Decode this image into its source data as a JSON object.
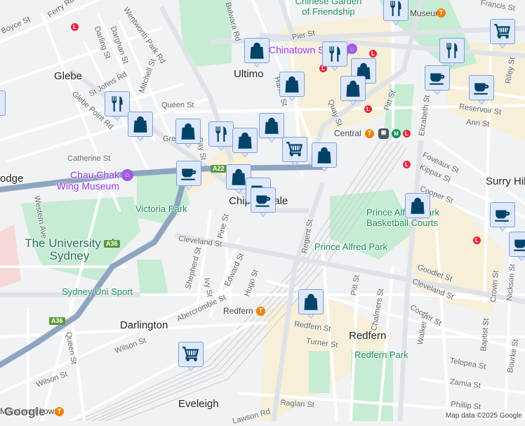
{
  "map": {
    "attribution": "Map data ©2025 Google",
    "logo": "Google",
    "marker_color": "#004369",
    "route_shields": [
      "A22",
      "A36",
      "A36"
    ],
    "suburbs": [
      "Glebe",
      "Ultimo",
      "Chippendale",
      "Darlington",
      "Redfern",
      "Eveleigh",
      "Surry Hills",
      "odge"
    ],
    "parks": [
      "Victoria Park",
      "Prince Alfred Park",
      "Redfern Park",
      "Sydney Uni Sport",
      "Prince Alfred Park Basketball Courts",
      "Chinese Garden of Friendship"
    ],
    "institutions": [
      "The University of Sydney"
    ],
    "pois": [
      "Chau Chak Wing Museum",
      "Chinatown Sydney"
    ],
    "stations": [
      "Central",
      "Redfern",
      "Museum",
      "Macdonaldtown"
    ],
    "streets": [
      "Wentworth Park Rd",
      "Glebe Point Rd",
      "St Johns Rd",
      "Mitchell St",
      "Darling St",
      "Darghan St",
      "Queen St",
      "Catherine St",
      "Cleveland St",
      "Cleveland St",
      "Abercrombie St",
      "Regent St",
      "Pitt St",
      "Pitt St",
      "Quay St",
      "Elizabeth St",
      "Foveaux St",
      "Kippax St",
      "Cooper St",
      "Cooper St",
      "Reservoir St",
      "Ann St",
      "Riley St",
      "Pier St",
      "Bulwara Rd",
      "Francis St",
      "Shepherd St",
      "Ivy St",
      "Pine St",
      "Edward St",
      "Hugo St",
      "Western Ave",
      "Queen St",
      "Wilson St",
      "Wilson St",
      "Redfern St",
      "Turner St",
      "Chalmers St",
      "Walker St",
      "Goodlet St",
      "Crown St",
      "Nickson St",
      "Baptist St",
      "Bourke St",
      "Telopea St",
      "Zamia St",
      "Raglan St",
      "Phillip St",
      "Boyce St",
      "Ferry Rd",
      "Harris St",
      "Greek St",
      "Bay St",
      "Lawson Rd"
    ],
    "markers": [
      "shopping",
      "restaurant",
      "shopping",
      "shopping",
      "restaurant",
      "shopping",
      "shopping",
      "shopping",
      "shopping",
      "shopping",
      "restaurant",
      "restaurant",
      "grocery",
      "restaurant",
      "cafe",
      "cafe",
      "grocery",
      "shopping",
      "shopping",
      "cafe",
      "cafe",
      "cafe",
      "shopping",
      "cafe",
      "cafe",
      "shopping",
      "grocery",
      "shopping"
    ]
  }
}
